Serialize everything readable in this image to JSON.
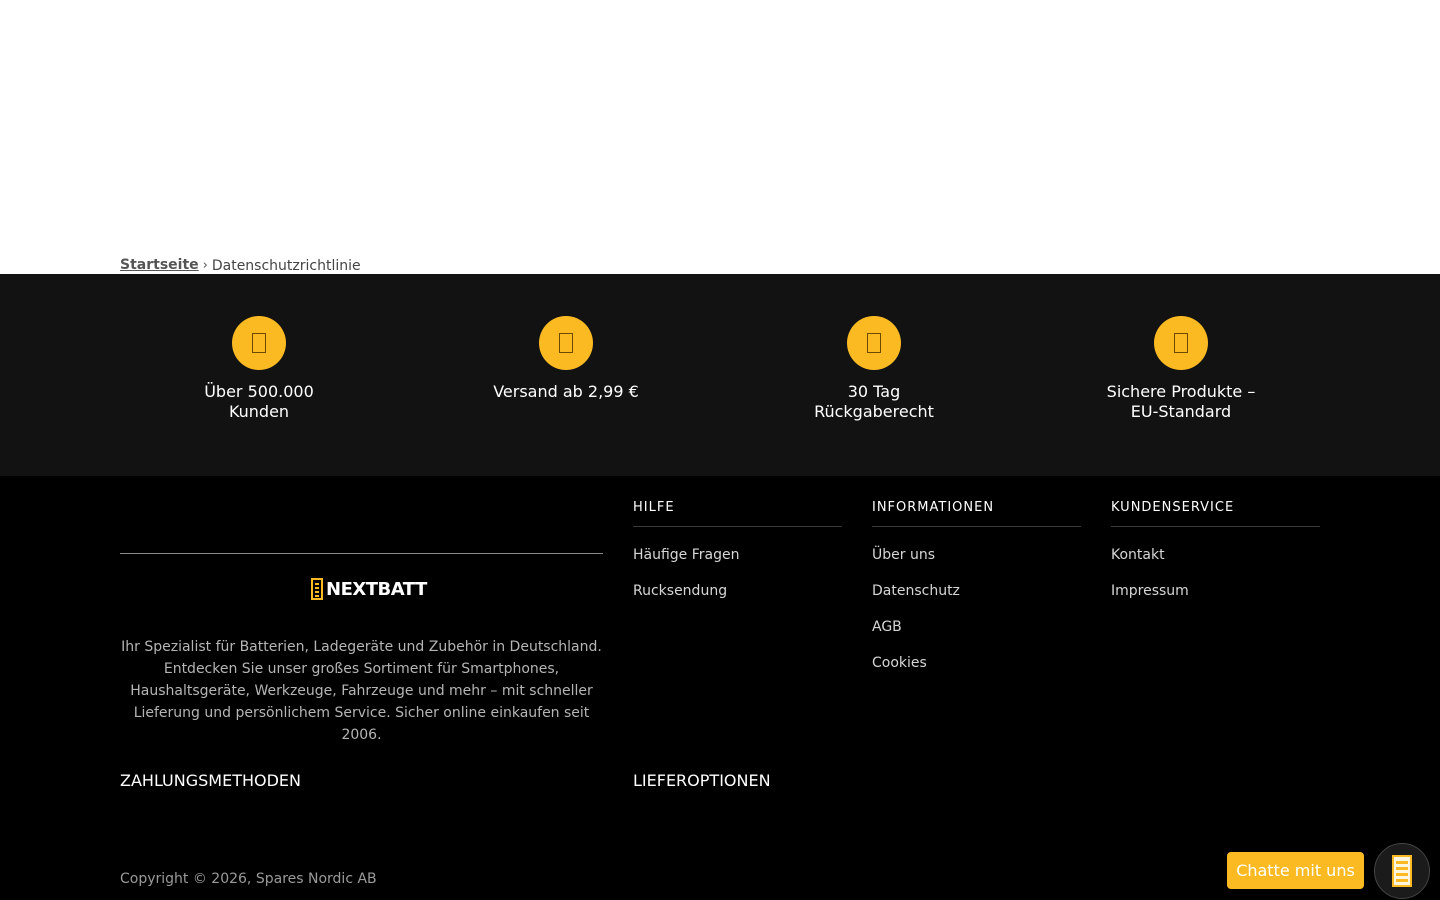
{
  "breadcrumb": {
    "home": "Startseite",
    "separator": "›",
    "current": "Datenschutzrichtlinie"
  },
  "usps": [
    {
      "icon": "users-icon",
      "label": "Über 500.000 Kunden"
    },
    {
      "icon": "truck-icon",
      "label": "Versand ab 2,99 €"
    },
    {
      "icon": "return-icon",
      "label": "30 Tag Rückgaberecht"
    },
    {
      "icon": "shield-icon",
      "label": "Sichere Produkte – EU-Standard"
    }
  ],
  "brand": {
    "logo_text": "NEXTBATT",
    "description": "Ihr Spezialist für Batterien, Ladegeräte und Zubehör in Deutschland. Entdecken Sie unser großes Sortiment für Smartphones, Haushaltsgeräte, Werkzeuge, Fahrzeuge und mehr – mit schneller Lieferung und persönlichem Service. Sicher online einkaufen seit 2006."
  },
  "columns": {
    "help": {
      "title": "HILFE",
      "links": [
        "Häufige Fragen",
        "Rucksendung"
      ]
    },
    "info": {
      "title": "INFORMATIONEN",
      "links": [
        "Über uns",
        "Datenschutz",
        "AGB",
        "Cookies"
      ]
    },
    "service": {
      "title": "KUNDENSERVICE",
      "links": [
        "Kontakt",
        "Impressum"
      ]
    }
  },
  "sections": {
    "payment": "ZAHLUNGSMETHODEN",
    "delivery": "LIEFEROPTIONEN"
  },
  "copyright": "Copyright © 2026, Spares Nordic AB",
  "chat": {
    "label": "Chatte mit uns"
  },
  "colors": {
    "accent": "#fbba22",
    "band": "#121212",
    "footer": "#000000"
  }
}
